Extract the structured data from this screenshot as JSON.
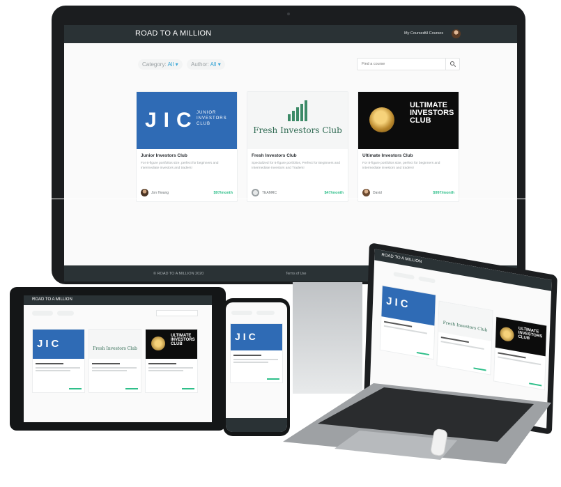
{
  "site": {
    "brand": "ROAD TO A MILLION",
    "nav": [
      "My Courses",
      "All Courses"
    ]
  },
  "filters": {
    "category_label": "Category:",
    "category_value": "All",
    "author_label": "Author:",
    "author_value": "All",
    "search_placeholder": "Find a course"
  },
  "courses": [
    {
      "title": "Junior Investors Club",
      "description": "For 6-figure portfolios size, perfect for beginners and intermediate investors and traders!",
      "author": "Jon Hwang",
      "price": "$97/month",
      "logo": {
        "letters": "JIC",
        "words": [
          "JUNIOR",
          "INVESTORS",
          "CLUB"
        ]
      }
    },
    {
      "title": "Fresh Investors Club",
      "description": "Specialized for 6-figure portfolios, Perfect for Beginners and Intermediate Investors and Traders!",
      "author": "TEAMRC",
      "price": "$47/month",
      "logo": {
        "name": "Fresh Investors Club"
      }
    },
    {
      "title": "Ultimate Investors Club",
      "description": "For 8-figure portfolios size, perfect for beginners and intermediate investors and traders!",
      "author": "David",
      "price": "$997/month",
      "logo": {
        "words": [
          "ULTIMATE",
          "INVESTORS",
          "CLUB"
        ]
      }
    }
  ],
  "footer": {
    "copyright": "© ROAD TO A MILLION 2020",
    "terms": "Terms of Use"
  },
  "colors": {
    "header": "#2a3235",
    "accent": "#3aa6d6",
    "price": "#2fbf8a",
    "jic_blue": "#2f6bb5"
  }
}
